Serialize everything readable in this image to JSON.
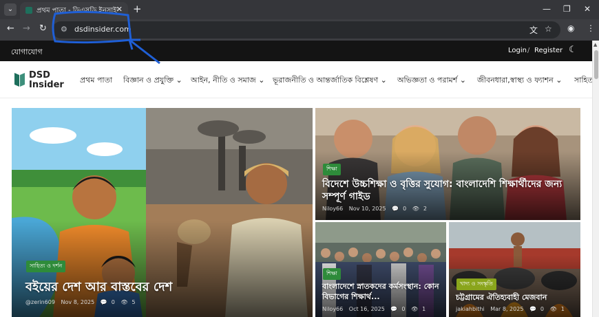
{
  "browser": {
    "tab_title": "প্রথম পাতা - ডিএসডি ইনসাইডার",
    "tab_close": "✕",
    "new_tab": "+",
    "url": "dsdinsider.com",
    "icons": [
      "tab-search-icon",
      "back-icon",
      "forward-icon",
      "reload-icon",
      "site-info-icon",
      "translate-icon",
      "star-icon",
      "profile-icon",
      "menu-icon",
      "minimize-icon",
      "maximize-icon",
      "close-icon"
    ]
  },
  "topbar": {
    "contact": "যোগাযোগ",
    "login": "Login",
    "separator": "/",
    "register": "Register"
  },
  "logo": {
    "line1": "DSD",
    "line2": "Insider",
    "accent": "#1e6f5c"
  },
  "nav": [
    {
      "label": "প্রথম পাতা"
    },
    {
      "label": "বিজ্ঞান ও প্রযুক্তি"
    },
    {
      "label": "আইন, নীতি ও সমাজ"
    },
    {
      "label": "ভূরাজনীতি ও আন্তর্জাতিক বিশ্লেষণ"
    },
    {
      "label": "অভিজ্ঞতা ও পরামর্শ"
    },
    {
      "label": "জীবনধারা,স্বাস্থ্য ও ফ্যাশন"
    },
    {
      "label": "সাহিত্য"
    }
  ],
  "articles": [
    {
      "category": "সাহিত্য ও দর্শন",
      "title": "বইয়ের দেশ আর বাস্তবের দেশ",
      "author": "@zerin609",
      "date": "Nov 8, 2025",
      "comments": "0",
      "views": "5",
      "badge_color": "#2e8b3a"
    },
    {
      "category": "শিক্ষা",
      "title": "বিদেশে উচ্চশিক্ষা ও বৃত্তির সুযোগ: বাংলাদেশি শিক্ষার্থীদের জন্য সম্পূর্ণ গাইড",
      "author": "Niloy66",
      "date": "Nov 10, 2025",
      "comments": "0",
      "views": "2",
      "badge_color": "#2e8b3a"
    },
    {
      "category": "শিক্ষা",
      "title": "বাংলাদেশে স্নাতকদের কর্মসংস্থান: কোন বিভাগের শিক্ষার্থ...",
      "author": "Niloy66",
      "date": "Oct 16, 2025",
      "comments": "0",
      "views": "1",
      "badge_color": "#2e8b3a"
    },
    {
      "category": "খাদ্য ও সংস্কৃতি",
      "title": "চট্টগ্রামের ঐতিহ্যবাহী মেজবান",
      "author": "jakiahbithi",
      "date": "Mar 8, 2025",
      "comments": "0",
      "views": "1",
      "badge_color": "#8aa51c"
    }
  ]
}
